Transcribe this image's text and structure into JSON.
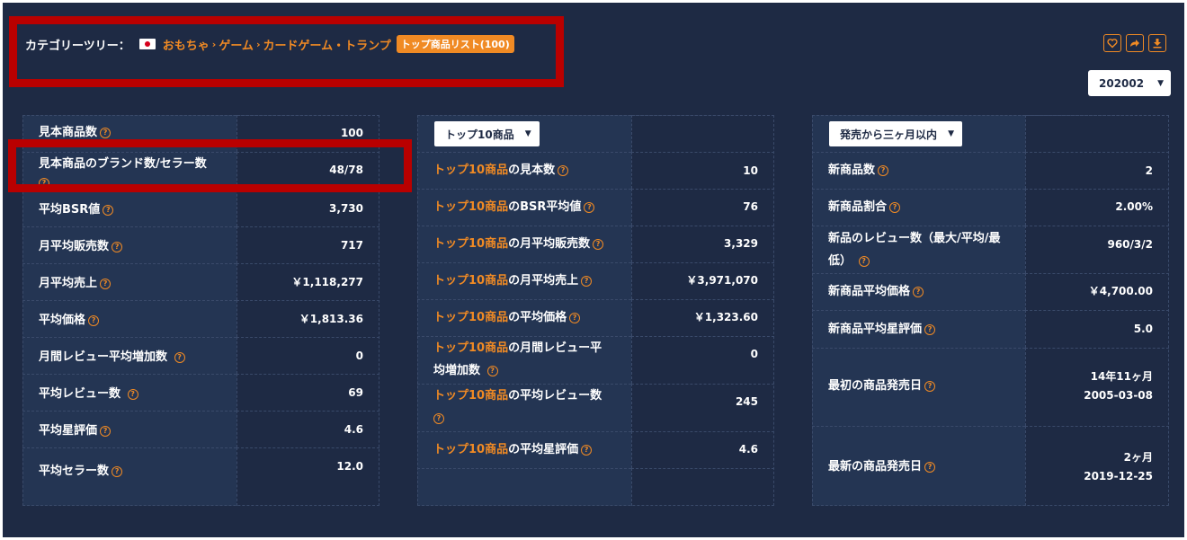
{
  "header": {
    "tree_label": "カテゴリーツリー：",
    "breadcrumbs": [
      "おもちゃ",
      "ゲーム",
      "カードゲーム・トランプ"
    ],
    "separator": "›",
    "top_list_badge": "トップ商品リスト(100)",
    "flag": "japan-flag"
  },
  "toolbar": {
    "icons": [
      "heart-icon",
      "share-icon",
      "download-icon"
    ],
    "month_selected": "202002"
  },
  "table1": {
    "rows": [
      {
        "label": "見本商品数",
        "value": "100"
      },
      {
        "label": "見本商品のブランド数/セラー数",
        "value": "48/78"
      },
      {
        "label": "平均BSR値",
        "value": "3,730"
      },
      {
        "label": "月平均販売数",
        "value": "717"
      },
      {
        "label": "月平均売上",
        "value": "￥1,118,277"
      },
      {
        "label": "平均価格",
        "value": "￥1,813.36"
      },
      {
        "label": "月間レビュー平均増加数",
        "value": "0"
      },
      {
        "label": "平均レビュー数",
        "value": "69"
      },
      {
        "label": "平均星評価",
        "value": "4.6"
      },
      {
        "label": "平均セラー数",
        "value": "12.0"
      }
    ]
  },
  "table2": {
    "dropdown": "トップ10商品",
    "highlight": "トップ10商品",
    "rows": [
      {
        "label": "の見本数",
        "value": "10"
      },
      {
        "label": "のBSR平均値",
        "value": "76"
      },
      {
        "label": "の月平均販売数",
        "value": "3,329"
      },
      {
        "label": "の月平均売上",
        "value": "￥3,971,070"
      },
      {
        "label": "の平均価格",
        "value": "￥1,323.60"
      },
      {
        "label": "の月間レビュー平",
        "label2": "均増加数",
        "value": "0"
      },
      {
        "label": "の平均レビュー数",
        "value": "245"
      },
      {
        "label": "の平均星評価",
        "value": "4.6"
      }
    ]
  },
  "table3": {
    "dropdown": "発売から三ヶ月以内",
    "rows": [
      {
        "label": "新商品数",
        "value": "2"
      },
      {
        "label": "新商品割合",
        "value": "2.00%"
      },
      {
        "label": "新品のレビュー数（最大/平均/最",
        "label2": "低）",
        "value": "960/3/2"
      },
      {
        "label": "新商品平均価格",
        "value": "￥4,700.00"
      },
      {
        "label": "新商品平均星評価",
        "value": "5.0"
      },
      {
        "label": "最初の商品発売日",
        "value": "14年11ヶ月",
        "value2": "2005-03-08"
      },
      {
        "label": "最新の商品発売日",
        "value": "2ヶ月",
        "value2": "2019-12-25"
      }
    ]
  },
  "help_glyph": "?",
  "dropdown_caret": "▼",
  "colors": {
    "background": "#1e2a44",
    "accent": "#f08a24",
    "annotation": "#b90000"
  }
}
